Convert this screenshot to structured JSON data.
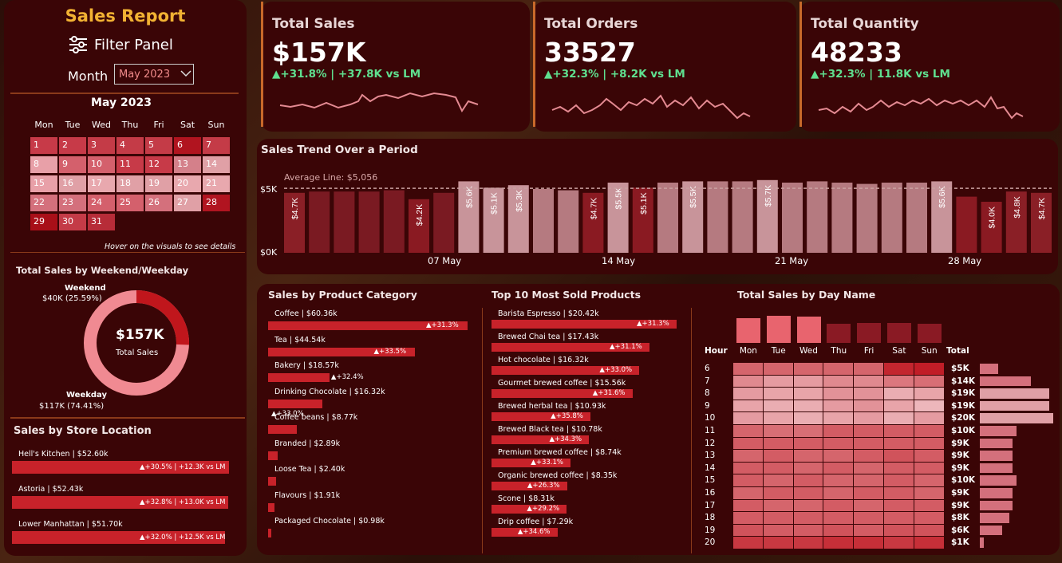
{
  "sidebar": {
    "title": "Sales Report",
    "filter_label": "Filter Panel",
    "month_label": "Month",
    "month_value": "May 2023",
    "calendar_title": "May 2023",
    "weekdays": [
      "Mon",
      "Tue",
      "Wed",
      "Thu",
      "Fri",
      "Sat",
      "Sun"
    ],
    "days": [
      "1",
      "2",
      "3",
      "4",
      "5",
      "6",
      "7",
      "8",
      "9",
      "10",
      "11",
      "12",
      "13",
      "14",
      "15",
      "16",
      "17",
      "18",
      "19",
      "20",
      "21",
      "22",
      "23",
      "24",
      "25",
      "26",
      "27",
      "28",
      "29",
      "30",
      "31"
    ],
    "hover_hint": "Hover on the visuals to see details"
  },
  "weekend": {
    "title": "Total Sales by Weekend/Weekday",
    "weekend_label": "Weekend",
    "weekend_value": "$40K (25.59%)",
    "weekday_label": "Weekday",
    "weekday_value": "$117K (74.41%)",
    "center_value": "$157K",
    "center_label": "Total Sales",
    "weekend_share": 25.59,
    "weekday_share": 74.41
  },
  "store": {
    "title": "Sales by Store Location",
    "items": [
      {
        "label": "Hell's Kitchen | $52.60k",
        "delta": "▲+30.5% | +12.3K vs LM",
        "value": 52.6
      },
      {
        "label": "Astoria | $52.43k",
        "delta": "▲+32.8% | +13.0K vs LM",
        "value": 52.43
      },
      {
        "label": "Lower Manhattan | $51.70k",
        "delta": "▲+32.0% | +12.5K vs LM",
        "value": 51.7
      }
    ]
  },
  "kpis": [
    {
      "label": "Total Sales",
      "value": "$157K",
      "change": "▲+31.8% | +37.8K vs LM"
    },
    {
      "label": "Total Orders",
      "value": "33527",
      "change": "▲+32.3% | +8.2K vs LM"
    },
    {
      "label": "Total Quantity",
      "value": "48233",
      "change": "▲+32.3% | 11.8K vs LM"
    }
  ],
  "trend": {
    "title": "Sales Trend Over a Period",
    "avg_label": "Average Line: $5,056",
    "y_ticks": [
      "$5K",
      "$0K"
    ],
    "x_ticks": [
      "07 May",
      "14 May",
      "21 May",
      "28 May"
    ]
  },
  "category": {
    "title": "Sales by Product Category",
    "items": [
      {
        "label": "Coffee | $60.36k",
        "delta": "▲+31.3%",
        "value": 60.36
      },
      {
        "label": "Tea | $44.54k",
        "delta": "▲+33.5%",
        "value": 44.54
      },
      {
        "label": "Bakery | $18.57k",
        "delta": "▲+32.4%",
        "value": 18.57
      },
      {
        "label": "Drinking Chocolate | $16.32k",
        "delta": "▲+33.0%",
        "value": 16.32
      },
      {
        "label": "Coffee beans | $8.77k",
        "delta": "",
        "value": 8.77
      },
      {
        "label": "Branded | $2.89k",
        "delta": "",
        "value": 2.89
      },
      {
        "label": "Loose Tea | $2.40k",
        "delta": "",
        "value": 2.4
      },
      {
        "label": "Flavours | $1.91k",
        "delta": "",
        "value": 1.91
      },
      {
        "label": "Packaged Chocolate | $0.98k",
        "delta": "",
        "value": 0.98
      }
    ]
  },
  "products": {
    "title": "Top 10 Most Sold Products",
    "items": [
      {
        "label": "Barista Espresso | $20.42k",
        "delta": "▲+31.3%",
        "value": 20.42
      },
      {
        "label": "Brewed Chai tea | $17.43k",
        "delta": "▲+31.1%",
        "value": 17.43
      },
      {
        "label": "Hot chocolate | $16.32k",
        "delta": "▲+33.0%",
        "value": 16.32
      },
      {
        "label": "Gourmet brewed coffee | $15.56k",
        "delta": "▲+31.6%",
        "value": 15.56
      },
      {
        "label": "Brewed herbal tea | $10.93k",
        "delta": "▲+35.8%",
        "value": 10.93
      },
      {
        "label": "Brewed Black tea | $10.78k",
        "delta": "▲+34.3%",
        "value": 10.78
      },
      {
        "label": "Premium brewed coffee | $8.74k",
        "delta": "▲+33.1%",
        "value": 8.74
      },
      {
        "label": "Organic brewed coffee | $8.35k",
        "delta": "▲+26.3%",
        "value": 8.35
      },
      {
        "label": "Scone | $8.31k",
        "delta": "▲+29.2%",
        "value": 8.31
      },
      {
        "label": "Drip coffee | $7.29k",
        "delta": "▲+34.6%",
        "value": 7.29
      }
    ]
  },
  "dayname": {
    "title": "Total Sales by Day Name",
    "hour_label": "Hour",
    "total_label": "Total",
    "days": [
      "Mon",
      "Tue",
      "Wed",
      "Thu",
      "Fri",
      "Sat",
      "Sun"
    ],
    "hours": [
      "6",
      "7",
      "8",
      "9",
      "10",
      "11",
      "12",
      "13",
      "14",
      "15",
      "16",
      "17",
      "18",
      "19",
      "20"
    ],
    "totals": [
      "$5K",
      "$14K",
      "$19K",
      "$19K",
      "$20K",
      "$10K",
      "$9K",
      "$9K",
      "$9K",
      "$10K",
      "$9K",
      "$9K",
      "$8K",
      "$6K",
      "$1K"
    ]
  },
  "chart_data": [
    {
      "type": "bar",
      "title": "Sales Trend Over a Period",
      "x": [
        "1",
        "2",
        "3",
        "4",
        "5",
        "6",
        "7",
        "8",
        "9",
        "10",
        "11",
        "12",
        "13",
        "14",
        "15",
        "16",
        "17",
        "18",
        "19",
        "20",
        "21",
        "22",
        "23",
        "24",
        "25",
        "26",
        "27",
        "28",
        "29",
        "30",
        "31"
      ],
      "values": [
        4.7,
        4.8,
        4.8,
        4.8,
        4.9,
        4.2,
        4.7,
        5.6,
        5.1,
        5.3,
        5.0,
        4.9,
        4.7,
        5.5,
        5.1,
        5.5,
        5.6,
        5.6,
        5.6,
        5.7,
        5.5,
        5.6,
        5.5,
        5.4,
        5.5,
        5.5,
        5.6,
        4.4,
        4.0,
        4.8,
        4.7
      ],
      "labels": [
        "$4.7K",
        "",
        "",
        "",
        "",
        "$4.2K",
        "",
        "$5.6K",
        "$5.1K",
        "$5.3K",
        "",
        "",
        "$4.7K",
        "$5.5K",
        "$5.1K",
        "",
        "$5.5K",
        "",
        "",
        "$5.7K",
        "",
        "",
        "",
        "",
        "",
        "",
        "$5.6K",
        "",
        "$4.0K",
        "$4.8K",
        "$4.7K"
      ],
      "average": 5056,
      "ylim": [
        0,
        6000
      ],
      "y_ticks": [
        "$5K",
        "$0K"
      ],
      "x_ticks": [
        "07 May",
        "14 May",
        "21 May",
        "28 May"
      ]
    },
    {
      "type": "heatmap",
      "title": "Total Sales by Day Name",
      "days": [
        "Mon",
        "Tue",
        "Wed",
        "Thu",
        "Fri",
        "Sat",
        "Sun"
      ],
      "hours": [
        "6",
        "7",
        "8",
        "9",
        "10",
        "11",
        "12",
        "13",
        "14",
        "15",
        "16",
        "17",
        "18",
        "19",
        "20"
      ],
      "day_totals": [
        0.78,
        0.85,
        0.82,
        0.61,
        0.63,
        0.63,
        0.6
      ],
      "intensity": [
        [
          0.55,
          0.55,
          0.55,
          0.55,
          0.55,
          0.9,
          0.95
        ],
        [
          0.35,
          0.25,
          0.25,
          0.35,
          0.35,
          0.45,
          0.5
        ],
        [
          0.25,
          0.2,
          0.2,
          0.3,
          0.3,
          0.15,
          0.2
        ],
        [
          0.2,
          0.15,
          0.15,
          0.25,
          0.3,
          0.2,
          0.1
        ],
        [
          0.25,
          0.2,
          0.15,
          0.2,
          0.25,
          0.15,
          0.25
        ],
        [
          0.55,
          0.5,
          0.5,
          0.6,
          0.6,
          0.6,
          0.6
        ],
        [
          0.6,
          0.6,
          0.6,
          0.6,
          0.6,
          0.6,
          0.6
        ],
        [
          0.55,
          0.6,
          0.55,
          0.55,
          0.6,
          0.65,
          0.6
        ],
        [
          0.6,
          0.6,
          0.55,
          0.6,
          0.55,
          0.6,
          0.6
        ],
        [
          0.6,
          0.55,
          0.6,
          0.55,
          0.55,
          0.6,
          0.55
        ],
        [
          0.55,
          0.6,
          0.6,
          0.55,
          0.6,
          0.6,
          0.55
        ],
        [
          0.6,
          0.55,
          0.55,
          0.6,
          0.55,
          0.6,
          0.6
        ],
        [
          0.6,
          0.6,
          0.6,
          0.6,
          0.6,
          0.6,
          0.6
        ],
        [
          0.65,
          0.6,
          0.6,
          0.65,
          0.6,
          0.65,
          0.65
        ],
        [
          0.8,
          0.8,
          0.8,
          0.85,
          0.85,
          0.8,
          0.85
        ]
      ],
      "hour_totals": [
        5,
        14,
        19,
        19,
        20,
        10,
        9,
        9,
        9,
        10,
        9,
        9,
        8,
        6,
        1
      ]
    }
  ],
  "colors": {
    "panel": "#3a0506",
    "bar_red": "#c8222a",
    "accent_gold": "#f2b233",
    "positive": "#5fe08f",
    "sparkline": "#e48a92"
  }
}
